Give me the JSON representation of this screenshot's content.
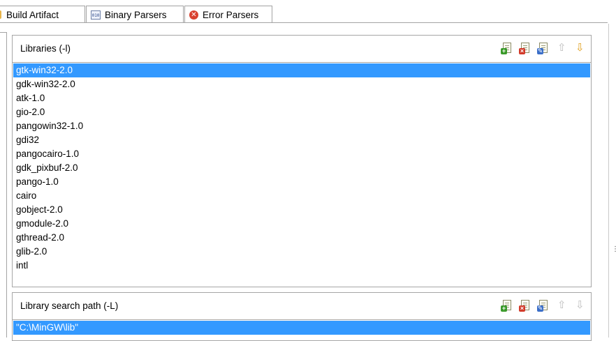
{
  "tabs": [
    {
      "label": "Build Artifact",
      "icon": "key-icon"
    },
    {
      "label": "Binary Parsers",
      "icon": "binary-icon",
      "icon_text": "010"
    },
    {
      "label": "Error Parsers",
      "icon": "error-icon",
      "icon_text": "✕"
    }
  ],
  "libraries": {
    "title": "Libraries (-l)",
    "items": [
      "gtk-win32-2.0",
      "gdk-win32-2.0",
      "atk-1.0",
      "gio-2.0",
      "pangowin32-1.0",
      "gdi32",
      "pangocairo-1.0",
      "gdk_pixbuf-2.0",
      "pango-1.0",
      "cairo",
      "gobject-2.0",
      "gmodule-2.0",
      "gthread-2.0",
      "glib-2.0",
      "intl"
    ],
    "selected_index": 0
  },
  "library_paths": {
    "title": "Library search path (-L)",
    "items": [
      "\"C:\\MinGW\\lib\""
    ],
    "selected_index": 0
  },
  "toolbar_glyphs": {
    "add": "+",
    "delete": "×",
    "edit": "✎",
    "up": "⇧",
    "down": "⇩"
  },
  "colors": {
    "selection": "#3399ff",
    "border": "#a6a6a6"
  }
}
